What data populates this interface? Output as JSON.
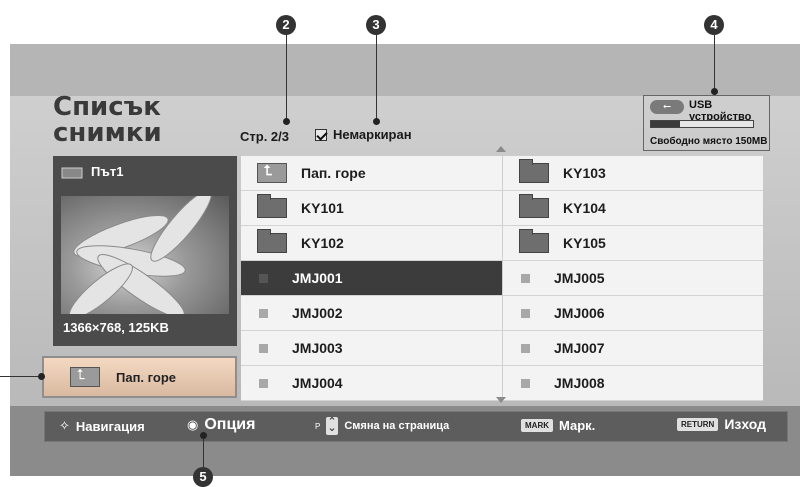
{
  "title": {
    "line1": "Списък",
    "line2": "снимки"
  },
  "page_info": "Стр. 2/3",
  "filter_label": "Немаркиран",
  "usb": {
    "label": "USB устройство",
    "free": "Свободно място 150MB",
    "used_fraction": 0.28
  },
  "preview": {
    "path": "Път1",
    "info": "1366×768, 125KB"
  },
  "up_button": {
    "label": "Пап. горе"
  },
  "files": {
    "left": [
      {
        "name": "Пап. горе",
        "type": "folder-up"
      },
      {
        "name": "KY101",
        "type": "folder"
      },
      {
        "name": "KY102",
        "type": "folder"
      },
      {
        "name": "JMJ001",
        "type": "file",
        "selected": true
      },
      {
        "name": "JMJ002",
        "type": "file"
      },
      {
        "name": "JMJ003",
        "type": "file"
      },
      {
        "name": "JMJ004",
        "type": "file"
      }
    ],
    "right": [
      {
        "name": "KY103",
        "type": "folder"
      },
      {
        "name": "KY104",
        "type": "folder"
      },
      {
        "name": "KY105",
        "type": "folder"
      },
      {
        "name": "JMJ005",
        "type": "file"
      },
      {
        "name": "JMJ006",
        "type": "file"
      },
      {
        "name": "JMJ007",
        "type": "file"
      },
      {
        "name": "JMJ008",
        "type": "file"
      }
    ]
  },
  "nav": {
    "navigation": "Навигация",
    "option": "Опция",
    "p_key": "P",
    "page_change": "Смяна на страница",
    "mark_key": "MARK",
    "mark": "Марк.",
    "return_key": "RETURN",
    "exit": "Изход"
  },
  "markers": [
    "2",
    "3",
    "4",
    "5"
  ],
  "colors": {
    "panel": "#c6c6c6",
    "selected_row": "#3c3c3c",
    "nav_bar": "#5d5d5d"
  }
}
